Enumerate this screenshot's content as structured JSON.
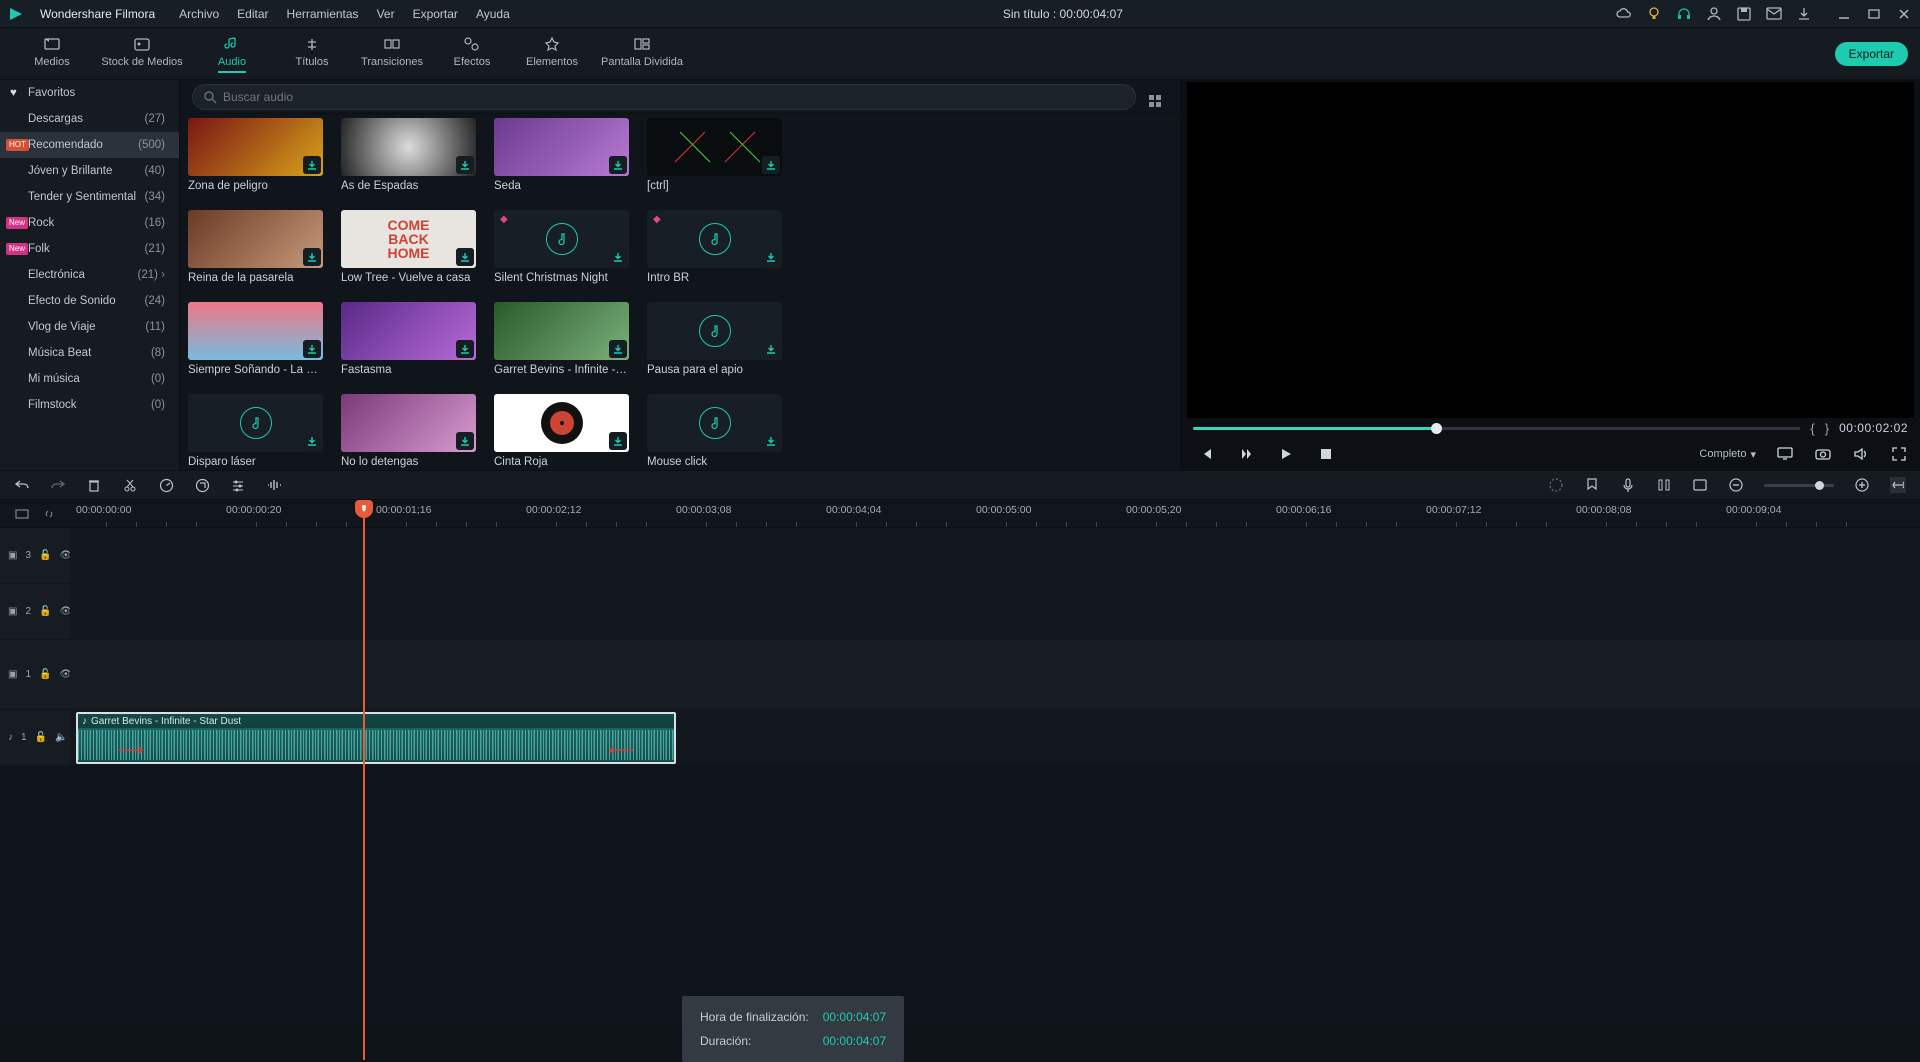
{
  "app_name": "Wondershare Filmora",
  "center_title": "Sin título : 00:00:04:07",
  "menus": [
    "Archivo",
    "Editar",
    "Herramientas",
    "Ver",
    "Exportar",
    "Ayuda"
  ],
  "tabs": [
    {
      "label": "Medios"
    },
    {
      "label": "Stock de Medios"
    },
    {
      "label": "Audio",
      "active": true
    },
    {
      "label": "Títulos"
    },
    {
      "label": "Transiciones"
    },
    {
      "label": "Efectos"
    },
    {
      "label": "Elementos"
    },
    {
      "label": "Pantalla Dividida"
    }
  ],
  "export_label": "Exportar",
  "search_placeholder": "Buscar audio",
  "categories": [
    {
      "label": "Favoritos",
      "count": "",
      "heart": true
    },
    {
      "label": "Descargas",
      "count": "(27)"
    },
    {
      "label": "Recomendado",
      "count": "(500)",
      "selected": true,
      "hot": true
    },
    {
      "label": "Jóven y Brillante",
      "count": "(40)"
    },
    {
      "label": "Tender y Sentimental",
      "count": "(34)"
    },
    {
      "label": "Rock",
      "count": "(16)",
      "new": true
    },
    {
      "label": "Folk",
      "count": "(21)",
      "new": true
    },
    {
      "label": "Electrónica",
      "count": "(21)",
      "chev": true
    },
    {
      "label": "Efecto de Sonido",
      "count": "(24)"
    },
    {
      "label": "Vlog de Viaje",
      "count": "(11)"
    },
    {
      "label": "Música Beat",
      "count": "(8)"
    },
    {
      "label": "Mi música",
      "count": "(0)"
    },
    {
      "label": "Filmstock",
      "count": "(0)"
    }
  ],
  "assets": [
    {
      "label": "Zona de peligro",
      "img": "grad1"
    },
    {
      "label": "As de Espadas",
      "img": "grad2"
    },
    {
      "label": "Seda",
      "img": "grad3"
    },
    {
      "label": "[ctrl]",
      "img": "ctrl"
    },
    {
      "label": "Reina de la pasarela",
      "img": "grad4"
    },
    {
      "label": "Low Tree - Vuelve a casa",
      "img": "back"
    },
    {
      "label": "Silent Christmas Night",
      "img": "note",
      "diamond": true
    },
    {
      "label": "Intro BR",
      "img": "note",
      "diamond": true
    },
    {
      "label": "Siempre Soñando - La …",
      "img": "grad5"
    },
    {
      "label": "Fastasma",
      "img": "grad6"
    },
    {
      "label": "Garret Bevins - Infinite -…",
      "img": "grad7"
    },
    {
      "label": "Pausa para el apio",
      "img": "note"
    },
    {
      "label": "Disparo láser",
      "img": "note"
    },
    {
      "label": "No lo detengas",
      "img": "grad8"
    },
    {
      "label": "Cinta Roja",
      "img": "vinyl"
    },
    {
      "label": "Mouse click",
      "img": "note"
    }
  ],
  "preview_time": "00:00:02:02",
  "quality_label": "Completo",
  "ruler_ticks": [
    "00:00:00:00",
    "00:00:00:20",
    "00:00:01;16",
    "00:00:02;12",
    "00:00:03;08",
    "00:00:04;04",
    "00:00:05:00",
    "00:00:05;20",
    "00:00:06;16",
    "00:00:07;12",
    "00:00:08;08",
    "00:00:09;04"
  ],
  "clip_title": "Garret Bevins - Infinite - Star Dust",
  "tooltip": {
    "end_label": "Hora de finalización:",
    "end_val": "00:00:04:07",
    "dur_label": "Duración:",
    "dur_val": "00:00:04:07"
  },
  "track_labels": [
    "3",
    "2",
    "1",
    "1"
  ]
}
